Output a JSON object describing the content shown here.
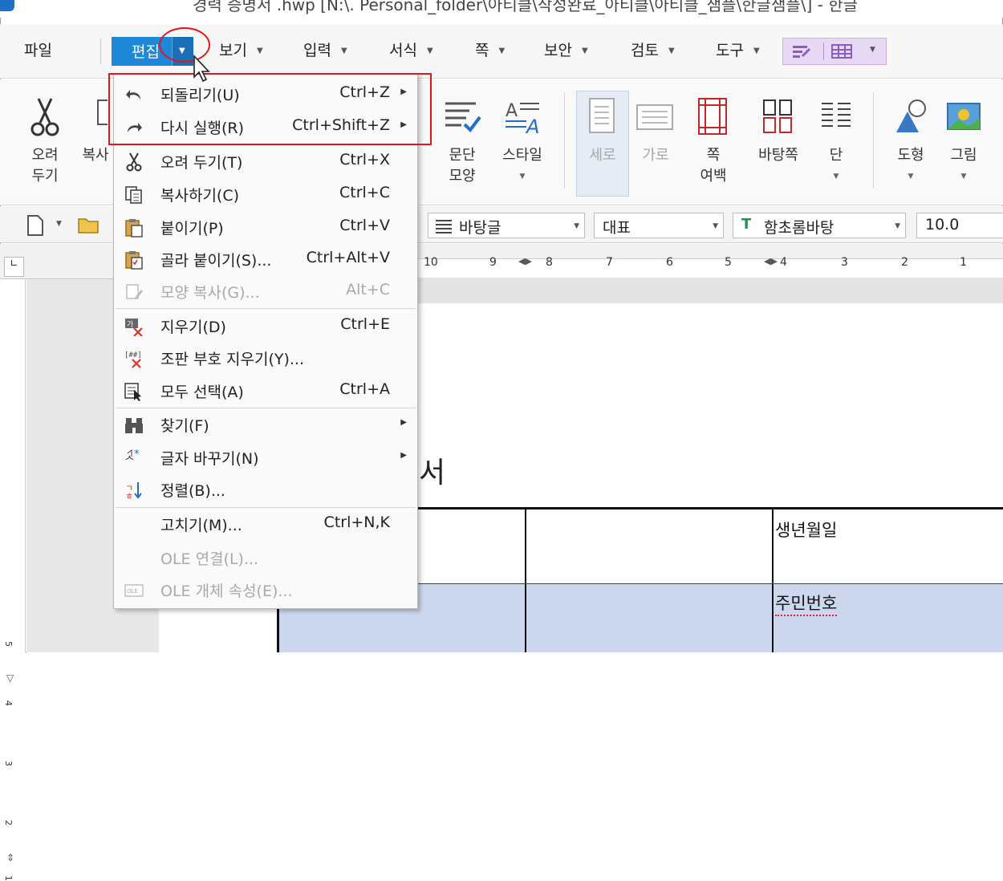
{
  "window": {
    "title": "경력 증명서 .hwp [N:\\. Personal_folder\\아티클\\작성완료_아티클\\아티클_샘플\\한글샘플\\] - 한글"
  },
  "menubar": {
    "items": [
      {
        "label": "파일"
      },
      {
        "label": "편집"
      },
      {
        "label": "보기"
      },
      {
        "label": "입력"
      },
      {
        "label": "서식"
      },
      {
        "label": "쪽"
      },
      {
        "label": "보안"
      },
      {
        "label": "검토"
      },
      {
        "label": "도구"
      }
    ],
    "active_index": 1,
    "accent_color": "#1e87d7"
  },
  "ribbon": {
    "cut_label": "오려\n두기",
    "copy_label": "복사",
    "para_label": "문단\n모양",
    "style_label": "스타일",
    "portrait_label": "세로",
    "landscape_label": "가로",
    "margin_label": "쪽\n여백",
    "master_label": "바탕쪽",
    "column_label": "단",
    "shape_label": "도형",
    "picture_label": "그림"
  },
  "format_toolbar": {
    "style_combo": "바탕글",
    "lang_combo": "대표",
    "font_combo": "함초롬바탕",
    "size_combo": "10.0"
  },
  "ruler": {
    "top_numbers": [
      "10",
      "9",
      "8",
      "7",
      "6",
      "5",
      "4",
      "3",
      "2",
      "1"
    ],
    "left_numbers": [
      "5",
      "4",
      "3",
      "2",
      "1"
    ]
  },
  "document": {
    "title_fragment": "서",
    "cell_birth": "생년월일",
    "cell_id": "주민번호"
  },
  "edit_menu": {
    "items": [
      {
        "label": "되돌리기(U)",
        "shortcut": "Ctrl+Z",
        "submenu": true,
        "enabled": true,
        "icon": "undo-icon"
      },
      {
        "label": "다시 실행(R)",
        "shortcut": "Ctrl+Shift+Z",
        "submenu": true,
        "enabled": true,
        "icon": "redo-icon"
      },
      {
        "label": "오려 두기(T)",
        "shortcut": "Ctrl+X",
        "submenu": false,
        "enabled": true,
        "icon": "scissors-icon"
      },
      {
        "label": "복사하기(C)",
        "shortcut": "Ctrl+C",
        "submenu": false,
        "enabled": true,
        "icon": "copy-icon"
      },
      {
        "label": "붙이기(P)",
        "shortcut": "Ctrl+V",
        "submenu": false,
        "enabled": true,
        "icon": "paste-icon"
      },
      {
        "label": "골라 붙이기(S)...",
        "shortcut": "Ctrl+Alt+V",
        "submenu": false,
        "enabled": true,
        "icon": "paste-special-icon"
      },
      {
        "label": "모양 복사(G)...",
        "shortcut": "Alt+C",
        "submenu": false,
        "enabled": false,
        "icon": "format-painter-icon"
      },
      {
        "label": "지우기(D)",
        "shortcut": "Ctrl+E",
        "submenu": false,
        "enabled": true,
        "icon": "erase-icon"
      },
      {
        "label": "조판 부호 지우기(Y)...",
        "shortcut": "",
        "submenu": false,
        "enabled": true,
        "icon": "erase-codes-icon"
      },
      {
        "label": "모두 선택(A)",
        "shortcut": "Ctrl+A",
        "submenu": false,
        "enabled": true,
        "icon": "select-all-icon"
      },
      {
        "label": "찾기(F)",
        "shortcut": "",
        "submenu": true,
        "enabled": true,
        "icon": "binoculars-icon"
      },
      {
        "label": "글자 바꾸기(N)",
        "shortcut": "",
        "submenu": true,
        "enabled": true,
        "icon": "change-case-icon"
      },
      {
        "label": "정렬(B)...",
        "shortcut": "",
        "submenu": false,
        "enabled": true,
        "icon": "sort-icon"
      },
      {
        "label": "고치기(M)...",
        "shortcut": "Ctrl+N,K",
        "submenu": false,
        "enabled": true,
        "icon": ""
      },
      {
        "label": "OLE 연결(L)...",
        "shortcut": "",
        "submenu": false,
        "enabled": false,
        "icon": ""
      },
      {
        "label": "OLE 개체 속성(E)...",
        "shortcut": "",
        "submenu": false,
        "enabled": false,
        "icon": "ole-icon"
      }
    ],
    "highlight_color": "#e0161e"
  }
}
